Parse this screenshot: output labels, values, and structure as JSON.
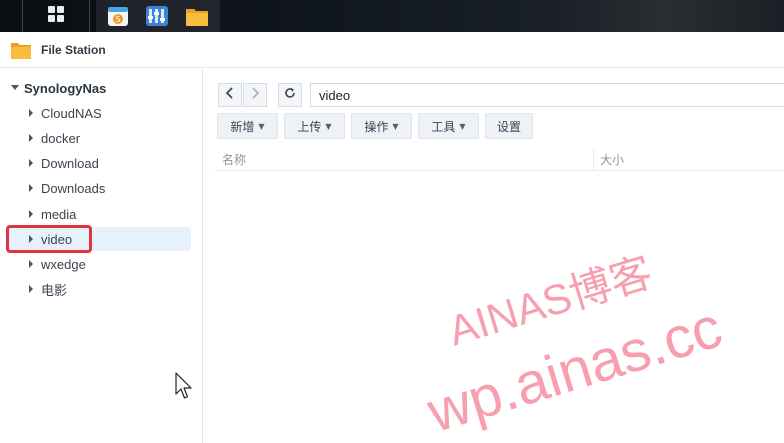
{
  "taskbar": {
    "apps": [
      {
        "icon": "main-menu-grid-icon"
      },
      {
        "icon": "package-center-icon"
      },
      {
        "icon": "control-panel-icon"
      },
      {
        "icon": "file-station-icon"
      }
    ]
  },
  "window": {
    "title": "File Station",
    "icon": "folder-icon"
  },
  "sidebar": {
    "root": "SynologyNas",
    "items": [
      {
        "label": "CloudNAS"
      },
      {
        "label": "docker"
      },
      {
        "label": "Download"
      },
      {
        "label": "Downloads"
      },
      {
        "label": "media"
      },
      {
        "label": "video",
        "selected": true
      },
      {
        "label": "wxedge"
      },
      {
        "label": "电影"
      }
    ]
  },
  "navigation": {
    "path": "video"
  },
  "toolbar": {
    "new_label": "新增",
    "upload_label": "上传",
    "action_label": "操作",
    "tools_label": "工具",
    "settings_label": "设置"
  },
  "list": {
    "columns": {
      "name": "名称",
      "size": "大小"
    }
  },
  "watermark": {
    "line1": "AINAS博客",
    "line2": "wp.ainas.cc",
    "color": "#f0506e"
  },
  "colors": {
    "selection_bg": "#e7f1fb",
    "highlight_border": "#e0343e",
    "folder_yellow": "#f5b73b"
  }
}
